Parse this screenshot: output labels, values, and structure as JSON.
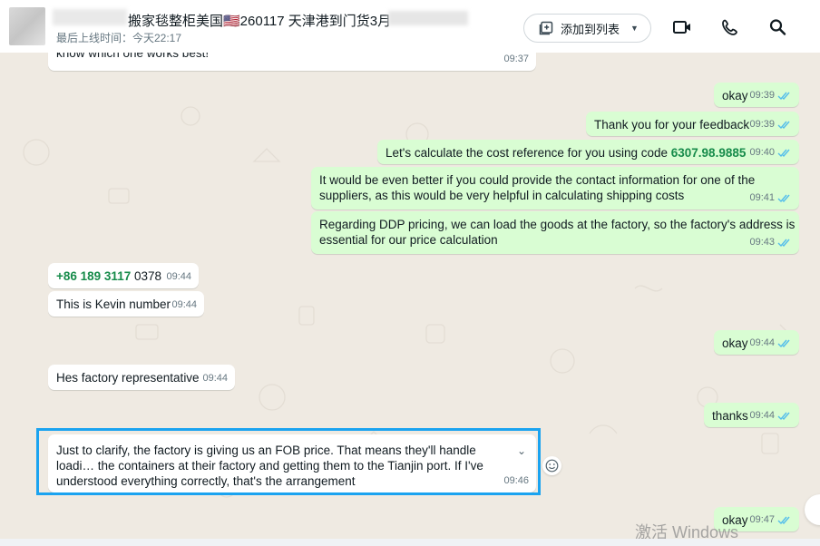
{
  "header": {
    "contact_name": "搬家毯整柜美国🇺🇸260117 天津港到门货3月",
    "last_seen": "最后上线时间：今天22:17",
    "add_to_list_label": "添加到列表",
    "icons": [
      "add-to-list-icon",
      "chevron-down-icon",
      "video-call-icon",
      "voice-call-icon",
      "search-icon"
    ]
  },
  "messages": [
    {
      "dir": "in",
      "text": "know which one works best!",
      "time": "09:37"
    },
    {
      "dir": "out",
      "text": "okay",
      "time": "09:39",
      "status": "read"
    },
    {
      "dir": "out",
      "text": "Thank you for your feedback",
      "time": "09:39",
      "status": "read"
    },
    {
      "dir": "out",
      "text_before": "Let's calculate the cost reference for you using code ",
      "code": "6307.98.9885",
      "time": "09:40",
      "status": "read"
    },
    {
      "dir": "out",
      "text": "It would be even better if you could provide the contact information for one of the suppliers, as this would be very helpful in calculating shipping costs",
      "time": "09:41",
      "status": "read"
    },
    {
      "dir": "out",
      "text": "Regarding DDP pricing, we can load the goods at the factory, so the factory's address is essential for our price calculation",
      "time": "09:43",
      "status": "read"
    },
    {
      "dir": "in",
      "phone": "+86 189 3117",
      "phone_rest": " 0378",
      "time": "09:44"
    },
    {
      "dir": "in",
      "text": "This is Kevin number",
      "time": "09:44"
    },
    {
      "dir": "out",
      "text": "okay",
      "time": "09:44",
      "status": "read"
    },
    {
      "dir": "in",
      "text": "Hes factory representative",
      "time": "09:44"
    },
    {
      "dir": "out",
      "text": "thanks",
      "time": "09:44",
      "status": "read"
    },
    {
      "dir": "in",
      "text": "Just to clarify, the factory is giving us an FOB price. That means they'll handle loadi… the containers at their factory and getting them to the Tianjin port. If I've understood everything correctly, that's the arrangement",
      "time": "09:46",
      "selected": true
    },
    {
      "dir": "out",
      "text": "okay",
      "time": "09:47",
      "status": "read"
    }
  ],
  "watermark": "激活 Windows",
  "colors": {
    "out_bubble": "#d9fdd3",
    "in_bubble": "#ffffff",
    "selection": "#1aa3f0",
    "read_tick": "#53bdeb",
    "code_green": "#168b4a"
  }
}
